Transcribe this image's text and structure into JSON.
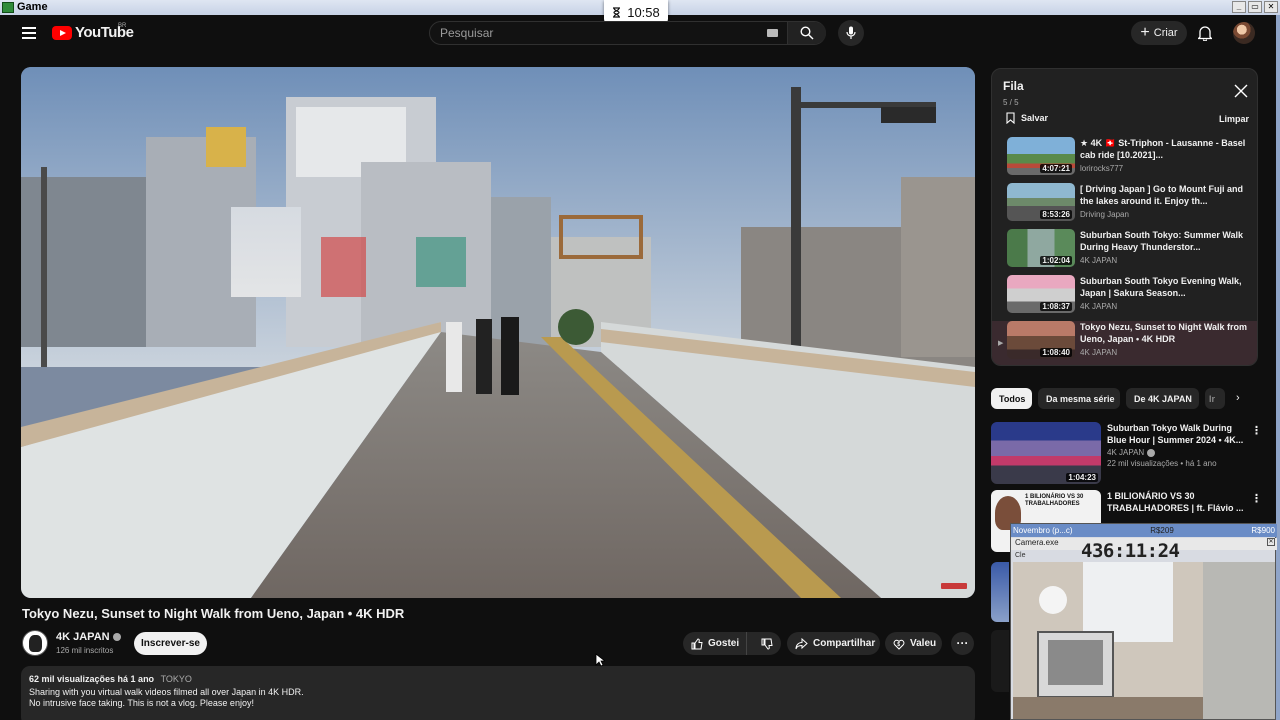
{
  "window": {
    "title": "Game",
    "buttons": [
      "_",
      "▭",
      "✕"
    ]
  },
  "clock": {
    "icon": "hourglass-icon",
    "time": "10:58"
  },
  "header": {
    "logo_text": "YouTube",
    "region": "BR",
    "search_placeholder": "Pesquisar",
    "create_label": "Criar"
  },
  "video": {
    "title": "Tokyo Nezu, Sunset to Night Walk from Ueno, Japan • 4K HDR",
    "channel": "4K JAPAN",
    "subscribers": "126 mil inscritos",
    "subscribe_label": "Inscrever-se",
    "like_label": "Gostei",
    "share_label": "Compartilhar",
    "thanks_label": "Valeu",
    "more_label": "···",
    "desc_meta": "62 mil visualizações  há 1 ano",
    "desc_tag": "TOKYO",
    "desc_line1": "Sharing with you virtual walk videos filmed all over Japan in 4K HDR.",
    "desc_line2": "No intrusive face taking. This is not a vlog. Please enjoy!"
  },
  "queue": {
    "title": "Fila",
    "count": "5 / 5",
    "save_label": "Salvar",
    "clear_label": "Limpar",
    "items": [
      {
        "title": "★ 4K 🇨🇭 St-Triphon - Lausanne - Basel cab ride [10.2021]...",
        "channel": "lorirocks777",
        "duration": "4:07:21",
        "active": false
      },
      {
        "title": "[ Driving Japan ] Go to Mount Fuji and the lakes around it. Enjoy th...",
        "channel": "Driving Japan",
        "duration": "8:53:26",
        "active": false
      },
      {
        "title": "Suburban South Tokyo: Summer Walk During Heavy Thunderstor...",
        "channel": "4K JAPAN",
        "duration": "1:02:04",
        "active": false
      },
      {
        "title": "Suburban South Tokyo Evening Walk, Japan | Sakura Season...",
        "channel": "4K JAPAN",
        "duration": "1:08:37",
        "active": false
      },
      {
        "title": "Tokyo Nezu, Sunset to Night Walk from Ueno, Japan • 4K HDR",
        "channel": "4K JAPAN",
        "duration": "1:08:40",
        "active": true
      }
    ]
  },
  "chips": [
    "Todos",
    "Da mesma série",
    "De 4K JAPAN",
    "Ir"
  ],
  "recommendations": [
    {
      "title": "Suburban Tokyo Walk During Blue Hour | Summer 2024 • 4K...",
      "channel": "4K JAPAN",
      "meta": "22 mil visualizações • há 1 ano",
      "duration": "1:04:23"
    },
    {
      "title": "1 BILIONÁRIO VS 30 TRABALHADORES | ft. Flávio ...",
      "channel": "",
      "meta": "",
      "duration": "",
      "thumb_text": "1 BILIONÁRIO VS 30 TRABALHADORES"
    }
  ],
  "overlay": {
    "left_label": "Novembro (p...c)",
    "mid_value": "R$209",
    "right_value": "R$900",
    "camera_label": "Camera.exe",
    "timer": "436:11:24",
    "caption": "Cle"
  },
  "colors": {
    "accent": "#ff0000",
    "bg": "#0f0f0f",
    "panel": "#212121",
    "active_queue": "#3a2a2f"
  }
}
